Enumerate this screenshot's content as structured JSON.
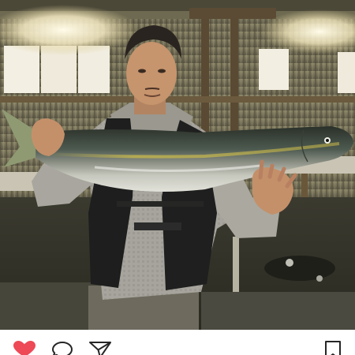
{
  "post": {
    "photo": {
      "subject": "man-holding-large-fish",
      "scene": "night-fishing-shed"
    },
    "actions": {
      "like": {
        "icon": "heart-icon",
        "liked": true,
        "color": "#ed4956"
      },
      "comment": {
        "icon": "comment-icon"
      },
      "share": {
        "icon": "paper-plane-icon"
      },
      "save": {
        "icon": "bookmark-icon"
      }
    }
  }
}
